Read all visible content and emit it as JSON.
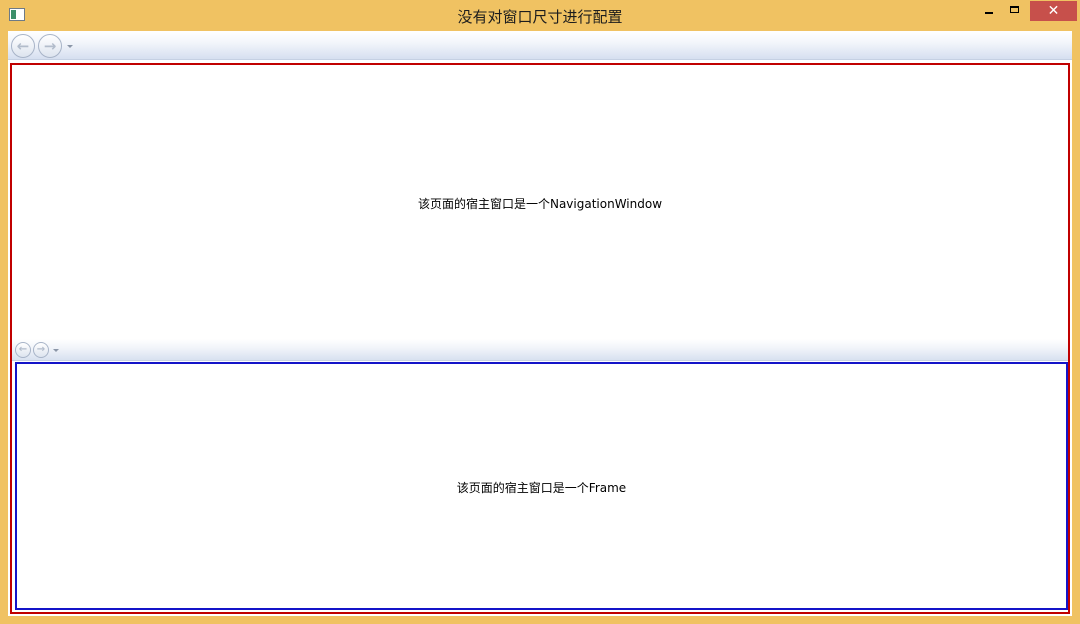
{
  "window": {
    "title": "没有对窗口尺寸进行配置",
    "close_glyph": "✕",
    "icons": {
      "app": "window-app-icon",
      "minimize": "minimize-icon",
      "maximize": "maximize-icon",
      "close": "close-icon"
    },
    "colors": {
      "frame": "#f0c262",
      "close_button": "#c7504b"
    }
  },
  "navigation_window": {
    "back_icon": "back-arrow-icon",
    "forward_icon": "forward-arrow-icon",
    "history_icon": "dropdown-arrow-icon",
    "back_glyph": "←",
    "forward_glyph": "→",
    "page_text": "该页面的宿主窗口是一个NavigationWindow",
    "border_color": "#c00000"
  },
  "frame": {
    "back_icon": "back-arrow-icon",
    "forward_icon": "forward-arrow-icon",
    "history_icon": "dropdown-arrow-icon",
    "back_glyph": "←",
    "forward_glyph": "→",
    "page_text": "该页面的宿主窗口是一个Frame",
    "border_color": "#1414c8"
  }
}
